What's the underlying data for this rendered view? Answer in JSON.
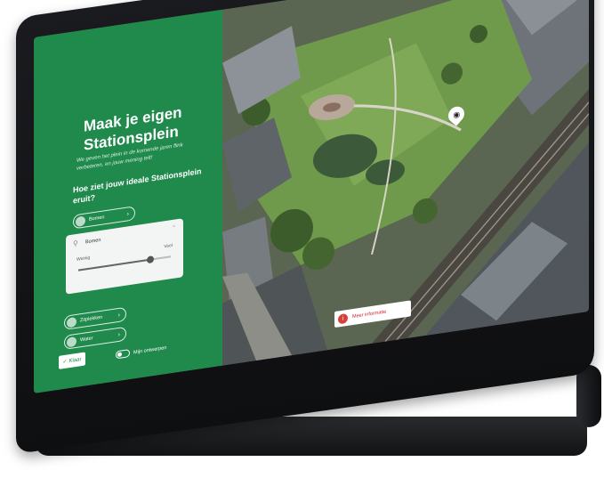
{
  "panel": {
    "title": "Maak je eigen Stationsplein",
    "intro": "We geven het plein in de komende jaren flink verbeteren, en jouw mening telt!",
    "question": "Hoe ziet jouw ideale Stationsplein eruit?",
    "options": [
      {
        "label": "Bomen",
        "icon": "tree-icon"
      },
      {
        "label": "Zitplekken",
        "icon": "bench-icon"
      },
      {
        "label": "Water",
        "icon": "water-icon"
      }
    ],
    "card": {
      "label": "Bomen",
      "min_label": "Weinig",
      "max_label": "Veel",
      "slider_value": 0.78
    },
    "submit_label": "Klaar",
    "toggle_label": "Mijn ontwerpen"
  },
  "map": {
    "info_button_label": "Meer informatie",
    "marker_icon": "eye-icon"
  },
  "colors": {
    "panel_green": "#1f8a4c",
    "accent_red": "#d6403a"
  }
}
